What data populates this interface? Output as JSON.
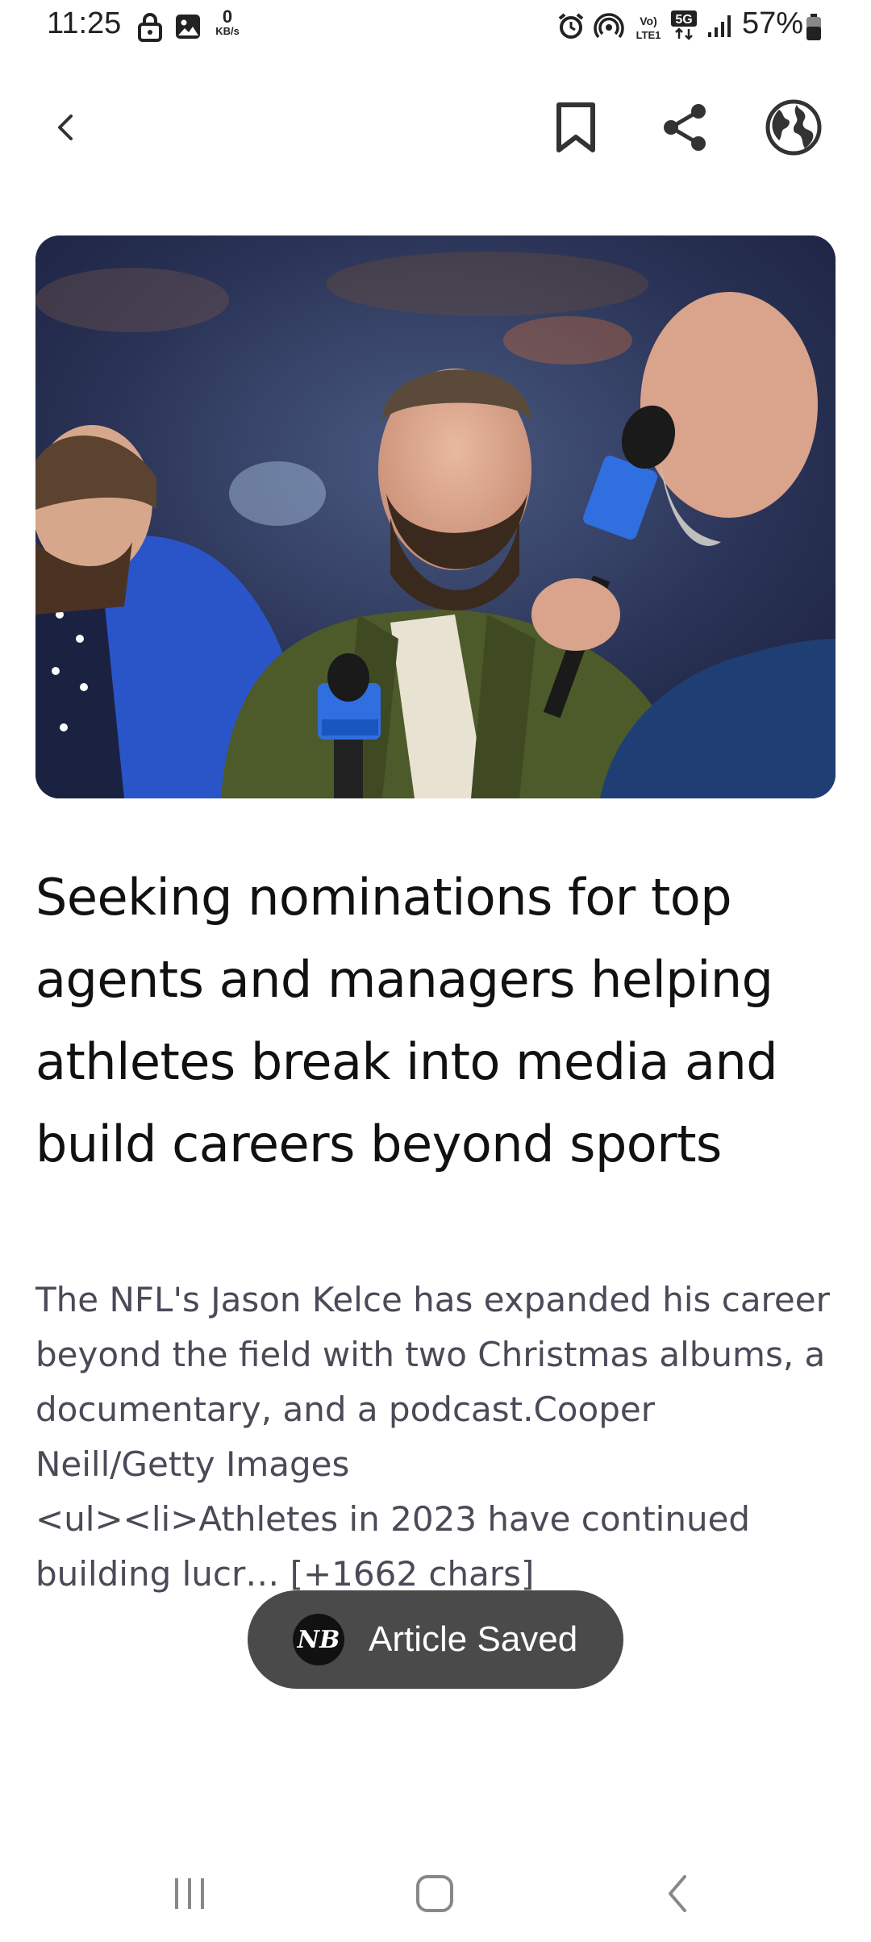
{
  "status_bar": {
    "time": "11:25",
    "net_speed_value": "0",
    "net_speed_unit": "KB/s",
    "network_label": "5G",
    "volte_label": "VoLTE1",
    "battery_percent": "57%",
    "icons": [
      "lock-icon",
      "image-icon",
      "alarm-icon",
      "hotspot-icon",
      "volte-icon",
      "5g-icon",
      "signal-icon",
      "battery-icon"
    ]
  },
  "toolbar": {
    "icons": [
      "back-icon",
      "bookmark-icon",
      "share-icon",
      "globe-icon"
    ]
  },
  "article": {
    "headline": "Seeking nominations for top agents and managers helping athletes break into media and build careers beyond sports",
    "body": "The NFL's Jason Kelce has expanded his career beyond the field with two Christmas albums, a documentary, and a podcast.Cooper Neill/Getty Images\n<ul><li>Athletes in 2023 have continued building lucr… [+1662 chars]"
  },
  "toast": {
    "logo_text": "NB",
    "message": "Article Saved"
  },
  "nav_bar": {
    "icons": [
      "recents-icon",
      "home-icon",
      "back-nav-icon"
    ]
  },
  "colors": {
    "toast_bg": "#4a4a4a",
    "body_text": "#4a4a58",
    "headline": "#111111"
  }
}
